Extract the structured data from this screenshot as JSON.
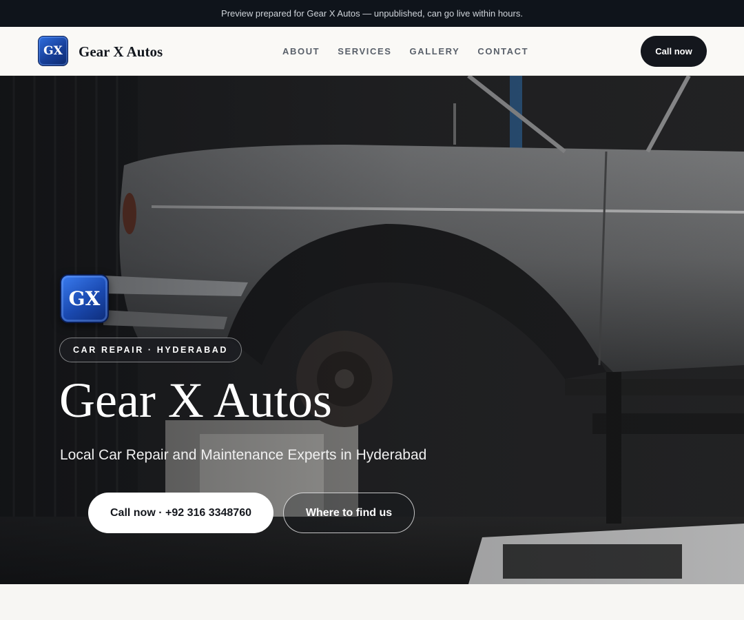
{
  "preview_bar": {
    "text": "Preview prepared for Gear X Autos — unpublished, can go live within hours."
  },
  "navbar": {
    "logo_text": "GX",
    "brand_name": "Gear X Autos",
    "links": [
      {
        "label": "ABOUT"
      },
      {
        "label": "SERVICES"
      },
      {
        "label": "GALLERY"
      },
      {
        "label": "CONTACT"
      }
    ],
    "cta_label": "Call now"
  },
  "hero": {
    "background_image": "car-on-lift-in-garage",
    "logo_text": "GX",
    "eyebrow": "CAR REPAIR · HYDERABAD",
    "title": "Gear X Autos",
    "subtitle": "Local Car Repair and Maintenance Experts in Hyderabad",
    "primary_button": "Call now · +92 316 3348760",
    "secondary_button": "Where to find us"
  },
  "colors": {
    "dark": "#0f141b",
    "accent_blue": "#1a49b0",
    "page_bg": "#f7f6f3"
  }
}
